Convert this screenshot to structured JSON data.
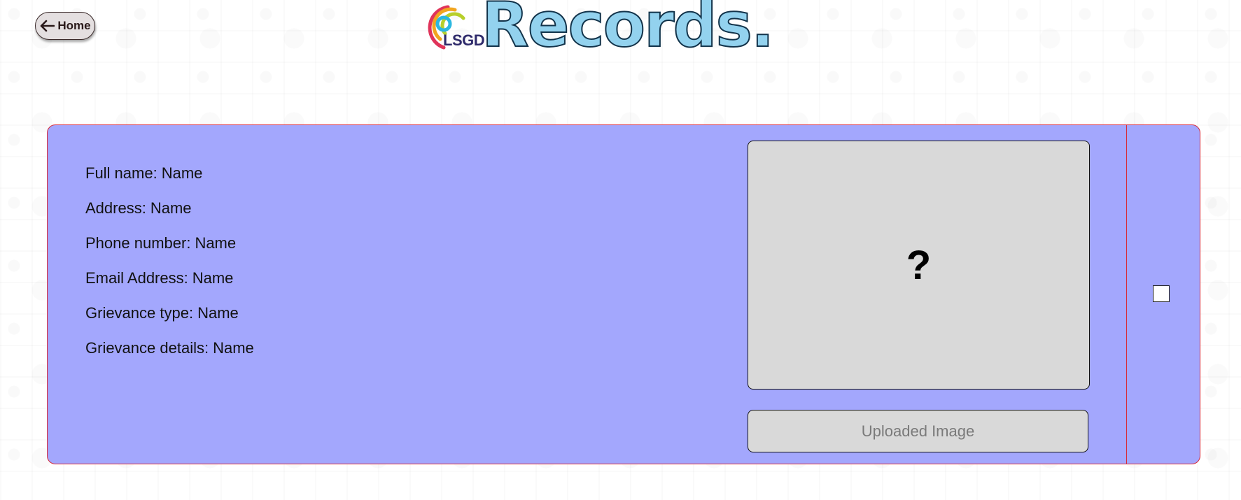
{
  "nav": {
    "home_label": "Home",
    "home_icon": "arrow-left-icon"
  },
  "header": {
    "logo_text": "LSGD",
    "title": "Records."
  },
  "record": {
    "fields": [
      {
        "label": "Full name:",
        "value": "Name"
      },
      {
        "label": "Address:",
        "value": "Name"
      },
      {
        "label": "Phone number:",
        "value": "Name"
      },
      {
        "label": "Email Address:",
        "value": "Name"
      },
      {
        "label": "Grievance type:",
        "value": "Name"
      },
      {
        "label": "Grievance details:",
        "value": "Name"
      }
    ],
    "image_placeholder": "?",
    "uploaded_image_label": "Uploaded Image",
    "selected": false
  },
  "colors": {
    "card_background": "#a3a7fd",
    "card_border": "#d82a3a",
    "title_fill": "#93d2ee",
    "image_box": "#d9d9d9"
  }
}
